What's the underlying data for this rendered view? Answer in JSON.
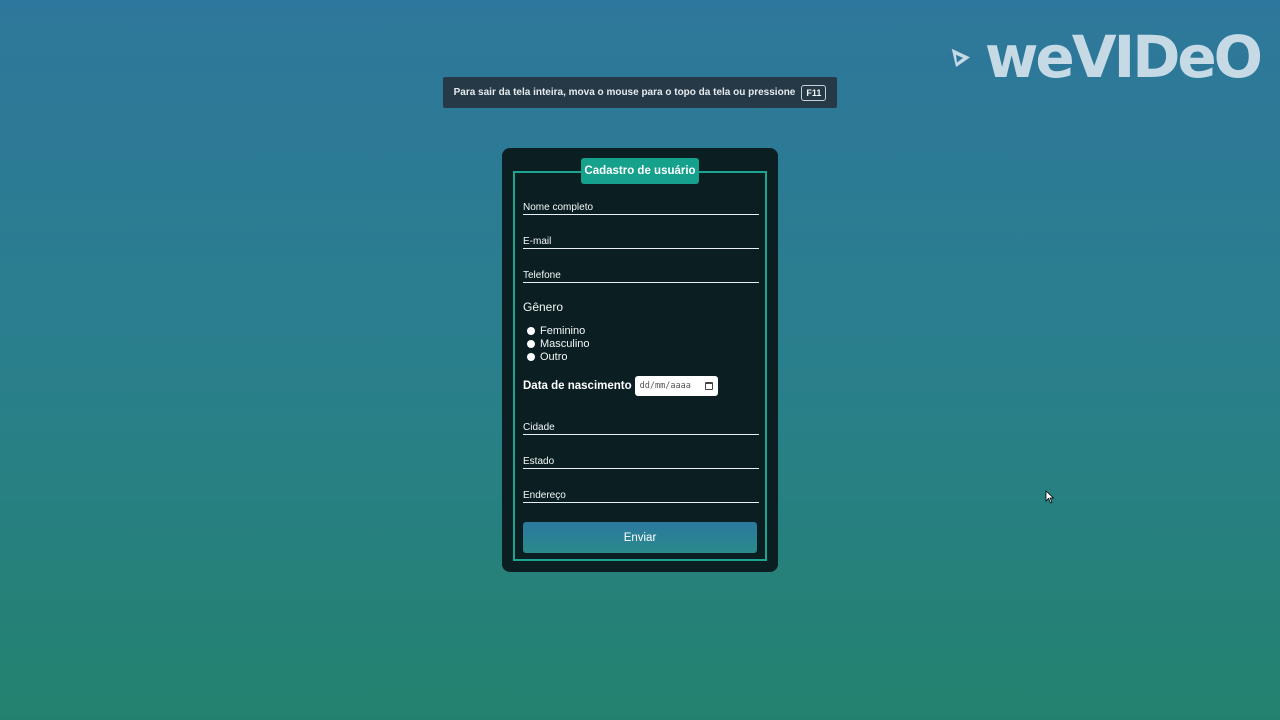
{
  "fullscreen_notice": {
    "message": "Para sair da tela inteira, mova o mouse para o topo da tela ou pressione",
    "key": "F11"
  },
  "watermark": {
    "text": "weVIDeO",
    "icon": "wevideo-logo-icon"
  },
  "form": {
    "legend": "Cadastro de usuário",
    "fields": {
      "nome": "Nome completo",
      "email": "E-mail",
      "telefone": "Telefone",
      "cidade": "Cidade",
      "estado": "Estado",
      "endereco": "Endereço"
    },
    "genero": {
      "title": "Gênero",
      "options": [
        "Feminino",
        "Masculino",
        "Outro"
      ]
    },
    "nascimento": {
      "label": "Data de nascimento",
      "placeholder": "dd/mm/aaaa",
      "icon": "calendar-icon"
    },
    "submit_label": "Enviar"
  },
  "colors": {
    "background_top": "#2e779c",
    "background_bottom": "#23826f",
    "card": "#0b1f23",
    "accent": "#16a18c"
  }
}
